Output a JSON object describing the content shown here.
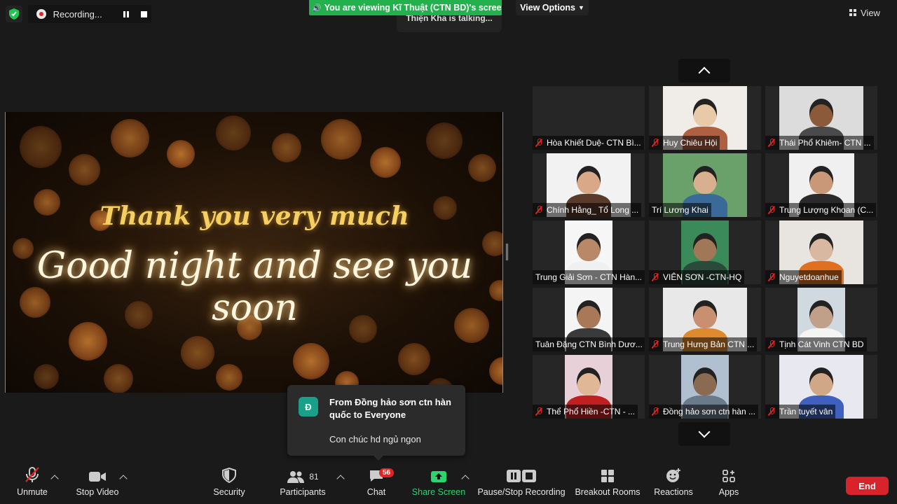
{
  "top": {
    "recording_label": "Recording...",
    "viewing_banner": "You are viewing Kĩ Thuật (CTN BD)'s screen",
    "talking": "Thiện Kha is talking...",
    "view_options": "View Options",
    "view": "View"
  },
  "share": {
    "line1": "Thank you very much",
    "line2": "Good night and see you soon"
  },
  "gallery": {
    "tiles": [
      {
        "name": "Hòa Khiết Duệ- CTN Bì...",
        "muted": true
      },
      {
        "name": "Huy Chiêu Hội",
        "muted": true
      },
      {
        "name": "Thái Phổ Khiêm- CTN ...",
        "muted": true
      },
      {
        "name": "Chính Hằng_ Tổ Long ...",
        "muted": true
      },
      {
        "name": "Trí Lương Khai",
        "muted": false
      },
      {
        "name": "Trung Lượng Khoan (C...",
        "muted": true
      },
      {
        "name": "Trung Giải Sơn - CTN Hàn...",
        "muted": false
      },
      {
        "name": "VIÊN SƠN -CTN-HQ",
        "muted": true
      },
      {
        "name": "Nguyetdoanhue",
        "muted": true
      },
      {
        "name": "Tuân Đặng CTN Bình Dươ...",
        "muted": false
      },
      {
        "name": "Trung Hưng Bản CTN ...",
        "muted": true
      },
      {
        "name": "Tịnh Cát Vinh CTN BD",
        "muted": true
      },
      {
        "name": "Thể Phổ Hiền -CTN - ...",
        "muted": true
      },
      {
        "name": "Đồng hảo sơn ctn hàn ...",
        "muted": true
      },
      {
        "name": "Trần tuyết vân",
        "muted": true
      }
    ]
  },
  "chat_popup": {
    "avatar": "Đ",
    "from": "From Đồng hảo sơn ctn hàn quốc to Everyone",
    "message": "Con chúc hd ngủ ngon"
  },
  "toolbar": {
    "unmute": "Unmute",
    "stop_video": "Stop Video",
    "security": "Security",
    "participants": "Participants",
    "participants_count": "81",
    "chat": "Chat",
    "chat_badge": "56",
    "share_screen": "Share Screen",
    "pause_recording": "Pause/Stop Recording",
    "breakout": "Breakout Rooms",
    "reactions": "Reactions",
    "apps": "Apps",
    "end": "End"
  },
  "colors": {
    "banner_green": "#22b14c",
    "end_red": "#d8232a",
    "share_green": "#2dd36f",
    "badge_red": "#e02424"
  }
}
